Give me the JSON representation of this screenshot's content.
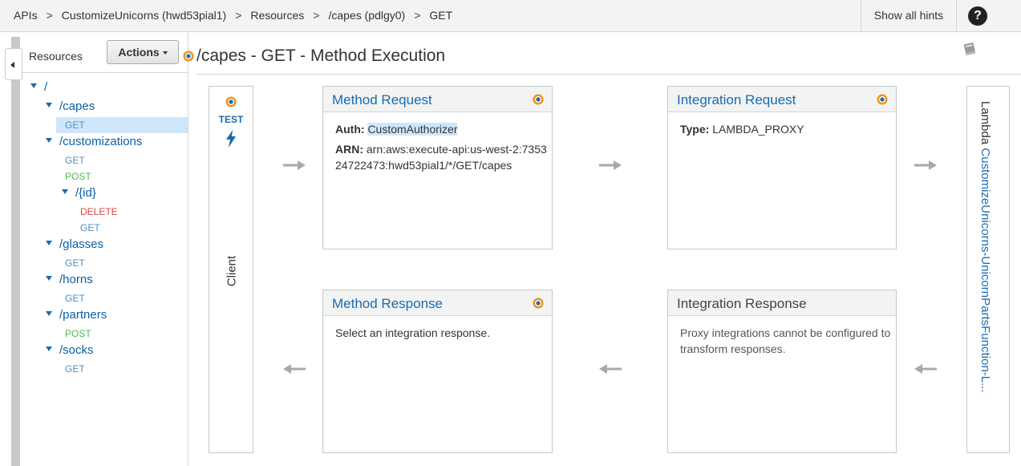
{
  "breadcrumb": [
    "APIs",
    "CustomizeUnicorns (hwd53pial1)",
    "Resources",
    "/capes (pdlgy0)",
    "GET"
  ],
  "breadcrumb_separator": ">",
  "header": {
    "hints_label": "Show all hints",
    "help_label": "?"
  },
  "sidebar": {
    "title": "Resources",
    "actions_label": "Actions",
    "tree": {
      "root": "/",
      "capes": "/capes",
      "capes_get": "GET",
      "customizations": "/customizations",
      "customizations_get": "GET",
      "customizations_post": "POST",
      "id": "/{id}",
      "id_delete": "DELETE",
      "id_get": "GET",
      "glasses": "/glasses",
      "glasses_get": "GET",
      "horns": "/horns",
      "horns_get": "GET",
      "partners": "/partners",
      "partners_post": "POST",
      "socks": "/socks",
      "socks_get": "GET"
    }
  },
  "main": {
    "title": "/capes - GET - Method Execution",
    "client": {
      "test_label": "TEST",
      "label": "Client"
    },
    "method_request": {
      "title": "Method Request",
      "auth_label": "Auth:",
      "auth_value": "CustomAuthorizer",
      "arn_label": "ARN:",
      "arn_value": "arn:aws:execute-api:us-west-2:735324722473:hwd53pial1/*/GET/capes"
    },
    "integration_request": {
      "title": "Integration Request",
      "type_label": "Type:",
      "type_value": "LAMBDA_PROXY"
    },
    "method_response": {
      "title": "Method Response",
      "body": "Select an integration response."
    },
    "integration_response": {
      "title": "Integration Response",
      "body": "Proxy integrations cannot be configured to transform responses."
    },
    "lambda": {
      "label": "Lambda",
      "function": "CustomizeUnicorns-UnicornPartsFunction-L..."
    }
  },
  "colors": {
    "link": "#1a6bb0",
    "get": "#4f8fc6",
    "post": "#55b855",
    "delete": "#d94545",
    "selected": "#cfe6fa",
    "dot": "#f28f1c"
  }
}
